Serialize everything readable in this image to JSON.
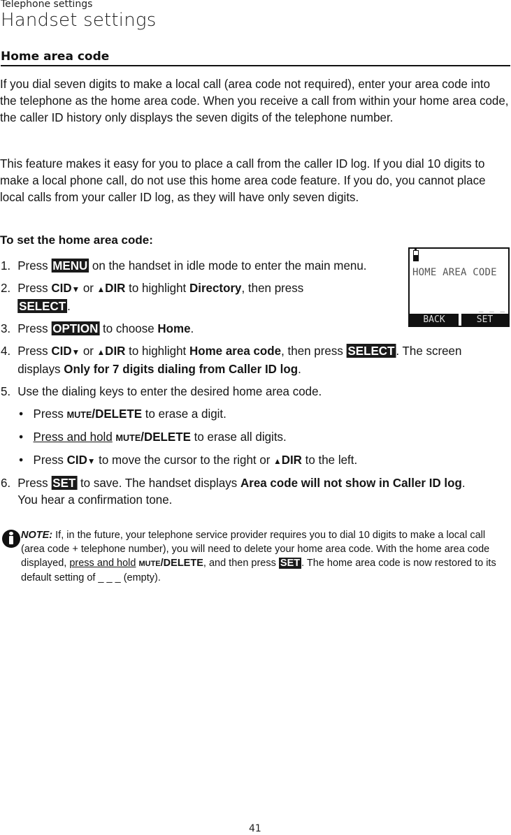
{
  "header": {
    "section": "Telephone settings",
    "title": "Handset settings"
  },
  "heading": "Home area code",
  "paragraphs": {
    "p1": "If you dial seven digits to make a local call (area code not required), enter your area code into the telephone as the home area code. When you receive a call from within your home area code, the caller ID history only displays the seven digits of the telephone number.",
    "p2": "This feature makes it easy for you to place a call from the caller ID log. If you dial 10 digits to make a local phone call, do not use this home area code feature. If you do, you cannot place local calls from your caller ID log, as they will have only seven digits."
  },
  "procedure_title": "To set the home area code:",
  "keys": {
    "menu": "MENU",
    "select": "SELECT",
    "option": "OPTION",
    "set": "SET",
    "cid": "CID",
    "dir": "DIR",
    "mute": "MUTE",
    "delete": "/DELETE",
    "down_arrow": "▼",
    "up_arrow": "▲"
  },
  "steps": [
    {
      "num": "1.",
      "a": "Press ",
      "b": " on the handset in idle mode to enter the main menu."
    },
    {
      "num": "2.",
      "a": "Press ",
      "or": " or ",
      "c": " to highlight ",
      "target": "Directory",
      "d": ", then press ",
      "end": "."
    },
    {
      "num": "3.",
      "a": "Press ",
      "b": " to choose ",
      "target": "Home",
      "end": "."
    },
    {
      "num": "4.",
      "a": "Press ",
      "or": " or ",
      "c": " to highlight ",
      "target": "Home area code",
      "d": ", then press ",
      "e": ". The screen displays ",
      "msg": "Only for 7 digits dialing from Caller ID log",
      "end": "."
    },
    {
      "num": "5.",
      "text": "Use the dialing keys to enter the desired home area code."
    },
    {
      "num": "6.",
      "a": "Press ",
      "b": " to save. The handset displays ",
      "msg": "Area code will not show in Caller ID log",
      "end": ". You hear a confirmation tone."
    }
  ],
  "bullets": [
    {
      "dot": "•",
      "a": "Press ",
      "end": " to erase a digit."
    },
    {
      "dot": "•",
      "u": "Press and hold",
      "a": " ",
      "end": " to erase all digits."
    },
    {
      "dot": "•",
      "a": "Press ",
      "mid": " to move the cursor to the right or ",
      "end": " to the left."
    }
  ],
  "lcd": {
    "title": "HOME AREA CODE",
    "cursor": "_ _ _",
    "softkey_left": "BACK",
    "softkey_right": "SET",
    "battery_level": 0.55
  },
  "note": {
    "label": "NOTE:",
    "a": " If, in the future, your telephone service provider requires you to dial 10 digits to make a local call (area code + telephone number), you will need to delete your home area code. With the home area code displayed, ",
    "u": "press and hold",
    "b": " ",
    "c": ", and then press ",
    "d": ". The home area code is now restored to its default setting of _ _ _ (empty)."
  },
  "page_number": "41"
}
